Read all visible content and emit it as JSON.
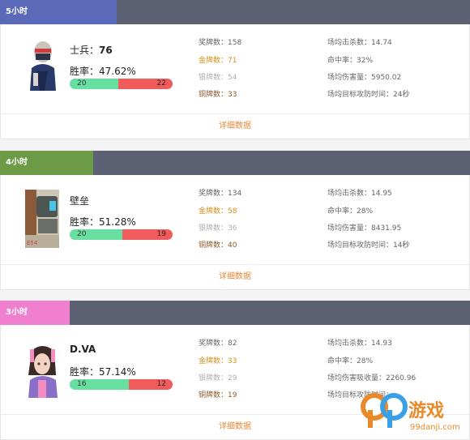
{
  "cards": [
    {
      "tag": "5小时",
      "tag_color": "#5b6ab8",
      "hero": "士兵",
      "hero_sep": "：",
      "hero_value": "76",
      "winrate_label": "胜率：",
      "winrate": "47.62%",
      "wins": "20",
      "losses": "22",
      "win_fraction": 0.476,
      "medals": "奖牌数：158",
      "gold": "金牌数：71",
      "silver": "银牌数：54",
      "bronze": "铜牌数：33",
      "kills": "场均击杀数：14.74",
      "accuracy": "命中率：32%",
      "damage": "场均伤害量：5950.02",
      "objective": "场均目标攻防时间：24秒",
      "details": "详细数据"
    },
    {
      "tag": "4小时",
      "tag_color": "#6d9a47",
      "hero": "壁垒",
      "hero_sep": "",
      "hero_value": "",
      "winrate_label": "胜率：",
      "winrate": "51.28%",
      "wins": "20",
      "losses": "19",
      "win_fraction": 0.513,
      "medals": "奖牌数：134",
      "gold": "金牌数：58",
      "silver": "银牌数：36",
      "bronze": "铜牌数：40",
      "kills": "场均击杀数：14.95",
      "accuracy": "命中率：28%",
      "damage": "场均伤害量：8431.95",
      "objective": "场均目标攻防时间：14秒",
      "details": "详细数据"
    },
    {
      "tag": "3小时",
      "tag_color": "#f17fcf",
      "hero": "D.VA",
      "hero_sep": "",
      "hero_value": "",
      "winrate_label": "胜率：",
      "winrate": "57.14%",
      "wins": "16",
      "losses": "12",
      "win_fraction": 0.571,
      "medals": "奖牌数：82",
      "gold": "金牌数：33",
      "silver": "银牌数：29",
      "bronze": "铜牌数：19",
      "kills": "场均击杀数：14.93",
      "accuracy": "命中率：28%",
      "damage": "场均伤害吸收量：2260.96",
      "objective": "场均目标攻防时间：",
      "details": "详细数据"
    }
  ],
  "watermark": {
    "text": "游戏",
    "url": "99danji.com"
  }
}
